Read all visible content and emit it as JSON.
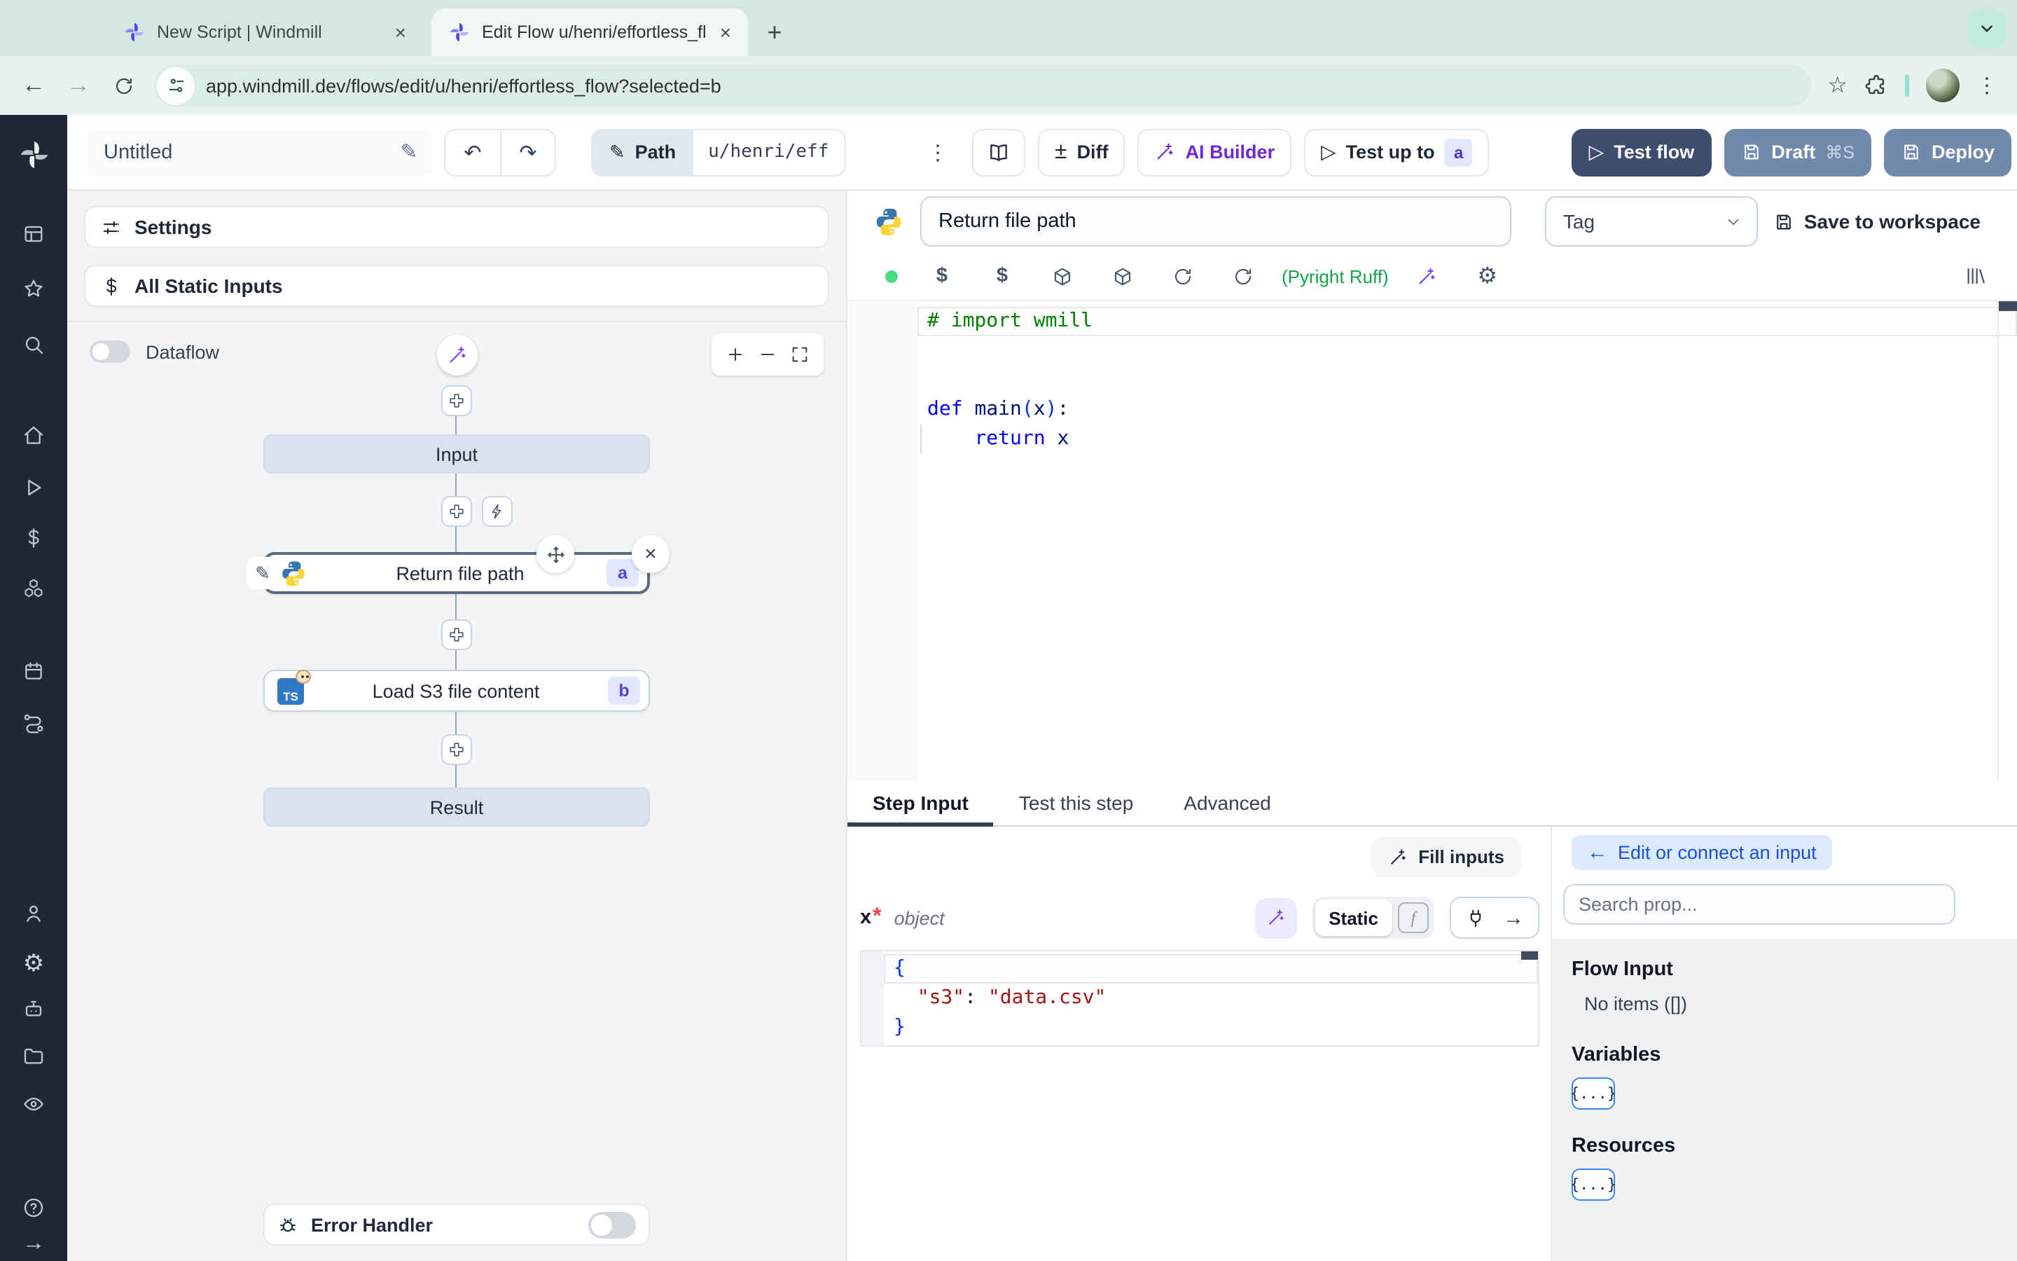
{
  "browser": {
    "tabs": [
      {
        "title": "New Script | Windmill"
      },
      {
        "title": "Edit Flow u/henri/effortless_fl"
      }
    ],
    "url": "app.windmill.dev/flows/edit/u/henri/effortless_flow?selected=b"
  },
  "icons": {
    "close": "×",
    "new_tab": "+",
    "back": "←",
    "forward": "→",
    "kebab_vertical": "⋮",
    "star": "☆",
    "pencil": "✎",
    "undo": "↶",
    "redo": "↷",
    "plus_minus": "±",
    "play": "▷",
    "gear": "⚙",
    "question": "?",
    "arrow_right": "→",
    "back_arrow": "←"
  },
  "header": {
    "name": "Untitled",
    "path_label": "Path",
    "path_value": "u/henri/eff",
    "diff_label": "Diff",
    "ai_builder_label": "AI Builder",
    "test_up_to_label": "Test up to",
    "test_up_to_badge": "a",
    "test_flow_label": "Test flow",
    "draft_label": "Draft",
    "draft_shortcut": "⌘S",
    "deploy_label": "Deploy"
  },
  "flow_panel": {
    "settings_label": "Settings",
    "static_inputs_label": "All Static Inputs",
    "dataflow_label": "Dataflow",
    "input_node": "Input",
    "step_a_label": "Return file path",
    "step_a_badge": "a",
    "step_b_label": "Load S3 file content",
    "step_b_badge": "b",
    "step_b_icon_text": "TS",
    "result_node": "Result",
    "error_handler_label": "Error Handler"
  },
  "step_editor": {
    "name_value": "Return file path",
    "tag_placeholder": "Tag",
    "save_label": "Save to workspace",
    "lint_label": "(Pyright Ruff)",
    "code": [
      [
        [
          "c",
          "# import wmill"
        ]
      ],
      [],
      [],
      [
        [
          "k",
          "def"
        ],
        [
          "p",
          " "
        ],
        [
          "v",
          "main"
        ],
        [
          "b",
          "("
        ],
        [
          "v",
          "x"
        ],
        [
          "b",
          ")"
        ],
        [
          "p",
          ":"
        ]
      ],
      [
        [
          "p",
          "    "
        ],
        [
          "k",
          "return"
        ],
        [
          "p",
          " "
        ],
        [
          "v",
          "x"
        ]
      ]
    ]
  },
  "bottom_tabs": {
    "step_input": "Step Input",
    "test_this_step": "Test this step",
    "advanced": "Advanced"
  },
  "step_input": {
    "fill_inputs_label": "Fill inputs",
    "prop_name": "x",
    "required_mark": "*",
    "prop_type": "object",
    "static_label": "Static",
    "fx_label": "f",
    "json": [
      [
        [
          "b",
          "{"
        ]
      ],
      [
        [
          "p",
          "  "
        ],
        [
          "s",
          "\"s3\""
        ],
        [
          "p",
          ": "
        ],
        [
          "s",
          "\"data.csv\""
        ]
      ],
      [
        [
          "b",
          "}"
        ]
      ]
    ]
  },
  "connect_panel": {
    "back_arrow": "←",
    "edit_connect_label": "Edit or connect an input",
    "search_placeholder": "Search prop...",
    "flow_input_title": "Flow Input",
    "flow_input_empty": "No items ([])",
    "variables_title": "Variables",
    "resources_title": "Resources",
    "braces_button": "{...}"
  },
  "colors": {
    "test_flow_bg": "#3d4d6e",
    "draft_deploy_bg": "#7089ac",
    "ai_purple": "#6d28d9",
    "badge_bg": "#e0e7ff",
    "badge_text": "#4338ca",
    "lint_green": "#16a34a",
    "selected_node_border": "#5b6b82",
    "sidebar_bg": "#1f2836",
    "chrome_bg": "#d6e6e2"
  }
}
